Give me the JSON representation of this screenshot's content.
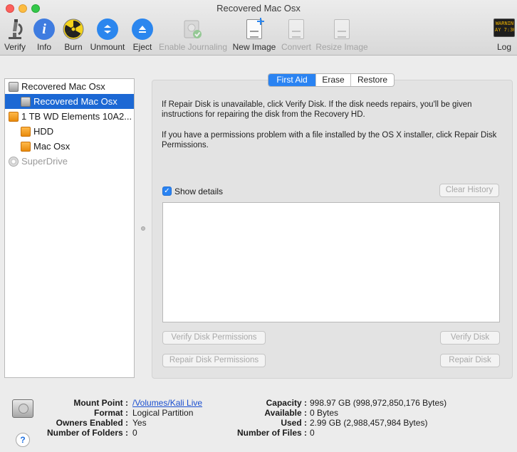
{
  "window": {
    "title": "Recovered Mac Osx"
  },
  "toolbar": {
    "verify": "Verify",
    "info": "Info",
    "burn": "Burn",
    "unmount": "Unmount",
    "eject": "Eject",
    "enable_journaling": "Enable Journaling",
    "new_image": "New Image",
    "convert": "Convert",
    "resize_image": "Resize Image",
    "log": "Log",
    "log_icon_text": "WARNIN",
    "log_icon_time": "AY 7:36"
  },
  "sidebar": {
    "items": [
      {
        "label": "Recovered Mac Osx",
        "level": 0,
        "icon": "internal-disk-icon"
      },
      {
        "label": "Recovered Mac Osx",
        "level": 1,
        "icon": "volume-icon",
        "selected": true
      },
      {
        "label": "1 TB WD Elements 10A2...",
        "level": 0,
        "icon": "external-disk-icon"
      },
      {
        "label": "HDD",
        "level": 1,
        "icon": "external-volume-icon"
      },
      {
        "label": "Mac Osx",
        "level": 1,
        "icon": "external-volume-icon"
      },
      {
        "label": "SuperDrive",
        "level": 0,
        "icon": "optical-drive-icon",
        "dimmed": true
      }
    ]
  },
  "tabs": [
    {
      "label": "First Aid",
      "active": true
    },
    {
      "label": "Erase",
      "active": false
    },
    {
      "label": "Restore",
      "active": false
    }
  ],
  "first_aid": {
    "paragraph1": "If Repair Disk is unavailable, click Verify Disk. If the disk needs repairs, you'll be given instructions for repairing the disk from the Recovery HD.",
    "paragraph2": "If you have a permissions problem with a file installed by the OS X installer, click Repair Disk Permissions.",
    "show_details_label": "Show details",
    "show_details_checked": true,
    "clear_history": "Clear History",
    "verify_permissions": "Verify Disk Permissions",
    "verify_disk": "Verify Disk",
    "repair_permissions": "Repair Disk Permissions",
    "repair_disk": "Repair Disk"
  },
  "disk_info": {
    "mount_point_label": "Mount Point :",
    "mount_point": "/Volumes/Kali Live",
    "format_label": "Format :",
    "format": "Logical Partition",
    "owners_label": "Owners Enabled :",
    "owners": "Yes",
    "folders_label": "Number of Folders :",
    "folders": "0",
    "capacity_label": "Capacity :",
    "capacity": "998.97 GB (998,972,850,176 Bytes)",
    "available_label": "Available :",
    "available": "0 Bytes",
    "used_label": "Used :",
    "used": "2.99 GB (2,988,457,984 Bytes)",
    "files_label": "Number of Files :",
    "files": "0"
  },
  "help": {
    "glyph": "?"
  },
  "colors": {
    "accent": "#2a83f2",
    "selection": "#1c68d4",
    "link": "#1a4fd0"
  }
}
